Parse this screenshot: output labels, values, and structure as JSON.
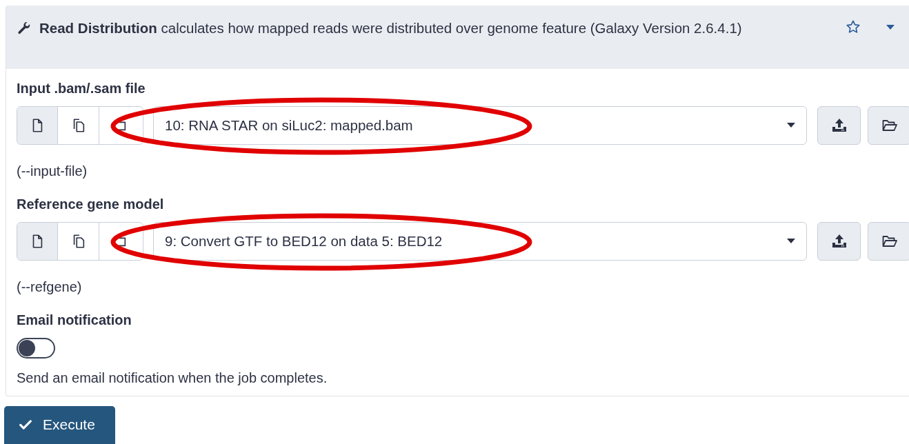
{
  "tool": {
    "name": "Read Distribution",
    "description": "calculates how mapped reads were distributed over genome feature (Galaxy Version 2.6.4.1)",
    "favorite": false
  },
  "params": [
    {
      "kind": "data",
      "label": "Input .bam/.sam file",
      "value": "10: RNA STAR on siLuc2: mapped.bam",
      "help": "(--input-file)",
      "circled": true
    },
    {
      "kind": "data",
      "label": "Reference gene model",
      "value": "9: Convert GTF to BED12 on data 5: BED12",
      "help": "(--refgene)",
      "circled": true
    },
    {
      "kind": "toggle",
      "label": "Email notification",
      "on": false,
      "help": "Send an email notification when the job completes."
    }
  ],
  "execute": "Execute"
}
